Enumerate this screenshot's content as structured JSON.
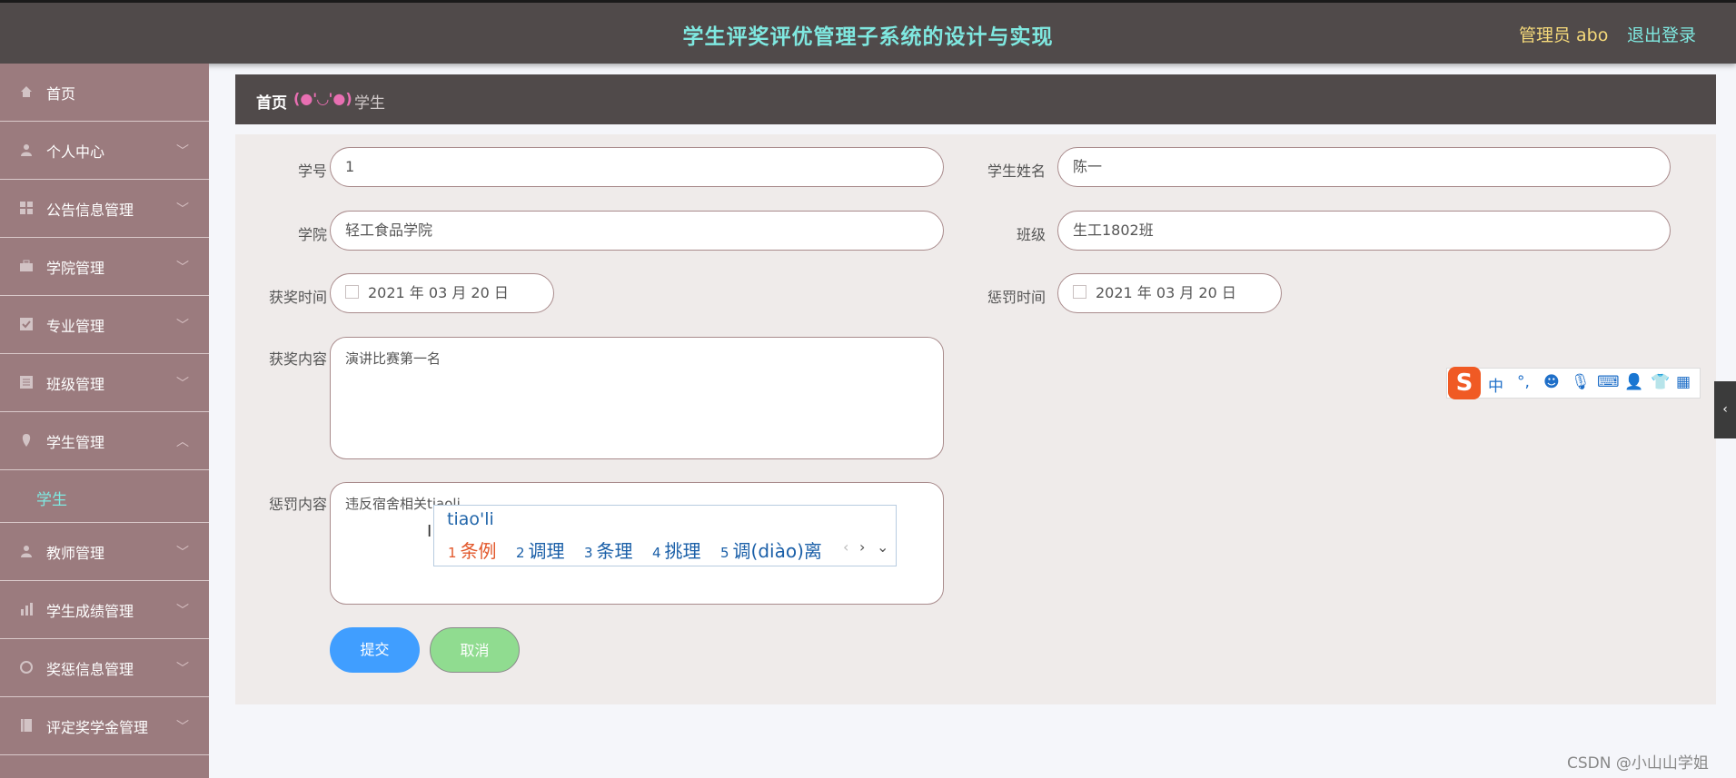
{
  "header": {
    "title": "学生评奖评优管理子系统的设计与实现",
    "admin": "管理员 abo",
    "logout": "退出登录"
  },
  "sidebar": {
    "items": [
      {
        "label": "首页",
        "icon": "home-icon"
      },
      {
        "label": "个人中心",
        "icon": "user-icon"
      },
      {
        "label": "公告信息管理",
        "icon": "grid-icon"
      },
      {
        "label": "学院管理",
        "icon": "briefcase-icon"
      },
      {
        "label": "专业管理",
        "icon": "check-icon"
      },
      {
        "label": "班级管理",
        "icon": "list-icon"
      },
      {
        "label": "学生管理",
        "icon": "pin-icon"
      },
      {
        "label": "教师管理",
        "icon": "user-icon"
      },
      {
        "label": "学生成绩管理",
        "icon": "chart-icon"
      },
      {
        "label": "奖惩信息管理",
        "icon": "circle-icon"
      },
      {
        "label": "评定奖学金管理",
        "icon": "book-icon"
      }
    ],
    "sub_active": "学生"
  },
  "breadcrumb": {
    "home": "首页",
    "face": "(●'◡'●)",
    "current": "学生"
  },
  "form": {
    "student_id_label": "学号",
    "student_id_value": "1",
    "student_name_label": "学生姓名",
    "student_name_value": "陈一",
    "college_label": "学院",
    "college_value": "轻工食品学院",
    "class_label": "班级",
    "class_value": "生工1802班",
    "award_time_label": "获奖时间",
    "award_time_value": "2021 年 03 月 20 日",
    "penalty_time_label": "惩罚时间",
    "penalty_time_value": "2021 年 03 月 20 日",
    "award_content_label": "获奖内容",
    "award_content_value": "演讲比赛第一名",
    "penalty_content_label": "惩罚内容",
    "penalty_content_value": "违反宿舍相关tiaoli",
    "submit": "提交",
    "cancel": "取消"
  },
  "ime": {
    "pinyin": "tiao'li",
    "candidates": [
      {
        "n": "1",
        "text": "条例"
      },
      {
        "n": "2",
        "text": "调理"
      },
      {
        "n": "3",
        "text": "条理"
      },
      {
        "n": "4",
        "text": "挑理"
      },
      {
        "n": "5",
        "text": "调(diào)离"
      }
    ],
    "toolbar_mode": "中",
    "toolbar_punct": "°,"
  },
  "watermark": "CSDN @小山山学姐",
  "colors": {
    "header_bg": "#504a4a",
    "sidebar_bg": "#9b7b7e",
    "accent": "#7fe8e0",
    "submit": "#409eff",
    "cancel": "#90dc90"
  }
}
